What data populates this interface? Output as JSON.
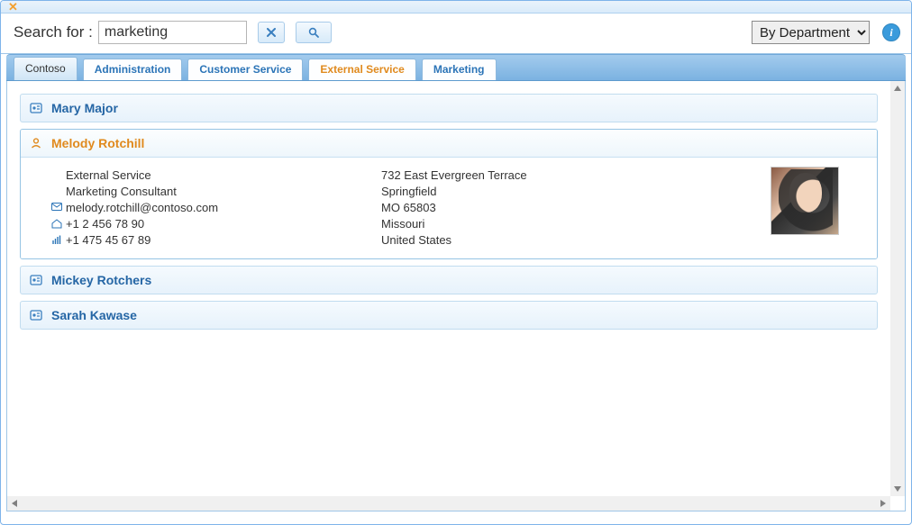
{
  "toolbar": {
    "search_label": "Search for :",
    "search_value": "marketing",
    "clear_icon": "close-icon",
    "search_icon": "magnifier-icon",
    "dropdown_selected": "By Department",
    "info_icon": "info-icon"
  },
  "tabs": {
    "root": "Contoso",
    "items": [
      {
        "label": "Administration",
        "active": false
      },
      {
        "label": "Customer Service",
        "active": false
      },
      {
        "label": "External Service",
        "active": true
      },
      {
        "label": "Marketing",
        "active": false
      }
    ]
  },
  "people": {
    "collapsed_above": [
      {
        "name": "Mary Major"
      }
    ],
    "expanded": {
      "name": "Melody Rotchill",
      "department": "External Service",
      "title": "Marketing Consultant",
      "email": "melody.rotchill@contoso.com",
      "phone_home": "+1 2 456 78 90",
      "phone_mobile": "+1 475 45 67 89",
      "addr1": "732 East Evergreen Terrace",
      "addr2": "Springfield",
      "addr3": "MO 65803",
      "addr4": "Missouri",
      "addr5": "United States"
    },
    "collapsed_below": [
      {
        "name": "Mickey Rotchers"
      },
      {
        "name": "Sarah Kawase"
      }
    ]
  }
}
